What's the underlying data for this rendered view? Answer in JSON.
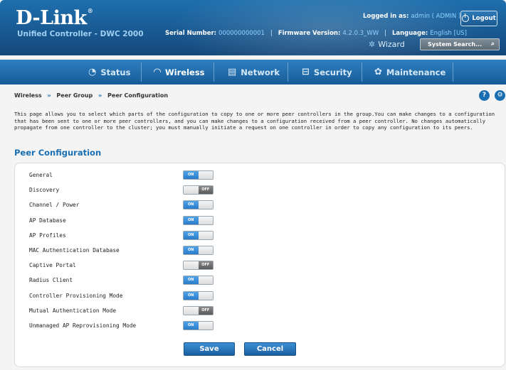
{
  "header": {
    "logo_text": "D-Link",
    "logo_mark": "®",
    "product": "Unified Controller - DWC 2000",
    "serial_label": "Serial Number:",
    "serial_value": "000000000001",
    "firmware_label": "Firmware Version:",
    "firmware_value": "4.2.0.3_WW",
    "language_label": "Language:",
    "language_value": "English [US]",
    "logged_in_label": "Logged in as:",
    "logged_in_value": "admin ( ADMIN )",
    "logout_label": "Logout",
    "wizard_label": "Wizard",
    "search_placeholder": "System Search..."
  },
  "nav": {
    "items": [
      {
        "label": "Status",
        "icon": "dashboard-icon"
      },
      {
        "label": "Wireless",
        "icon": "wifi-icon",
        "active": true
      },
      {
        "label": "Network",
        "icon": "network-icon"
      },
      {
        "label": "Security",
        "icon": "lock-icon"
      },
      {
        "label": "Maintenance",
        "icon": "gears-icon"
      }
    ]
  },
  "breadcrumb": {
    "items": [
      "Wireless",
      "Peer Group",
      "Peer Configuration"
    ],
    "separator": "»"
  },
  "description": "This page allows you to select which parts of the configuration to copy to one or more peer controllers in the group.You can make changes to a configuration that has been sent to one or more peer controllers, and you can make changes to a configuration received from a peer controller. No changes automatically propagate from one controller to the cluster; you must manually initiate a request on one controller in order to copy any configuration to its peers.",
  "section_title": "Peer Configuration",
  "toggle_labels": {
    "on": "ON",
    "off": "OFF"
  },
  "settings": [
    {
      "label": "General",
      "state": "on"
    },
    {
      "label": "Discovery",
      "state": "off"
    },
    {
      "label": "Channel / Power",
      "state": "on"
    },
    {
      "label": "AP Database",
      "state": "on"
    },
    {
      "label": "AP Profiles",
      "state": "on"
    },
    {
      "label": "MAC Authentication Database",
      "state": "on"
    },
    {
      "label": "Captive Portal",
      "state": "off"
    },
    {
      "label": "Radius Client",
      "state": "on"
    },
    {
      "label": "Controller Provisioning Mode",
      "state": "on"
    },
    {
      "label": "Mutual Authentication Mode",
      "state": "off"
    },
    {
      "label": "Unmanaged AP Reprovisioning Mode",
      "state": "on"
    }
  ],
  "buttons": {
    "save": "Save",
    "cancel": "Cancel"
  },
  "colors": {
    "brand_blue": "#1a6fb3",
    "header_blue": "#1a5e98",
    "toggle_on": "#2a7cc9",
    "toggle_off": "#5a5a5a"
  }
}
